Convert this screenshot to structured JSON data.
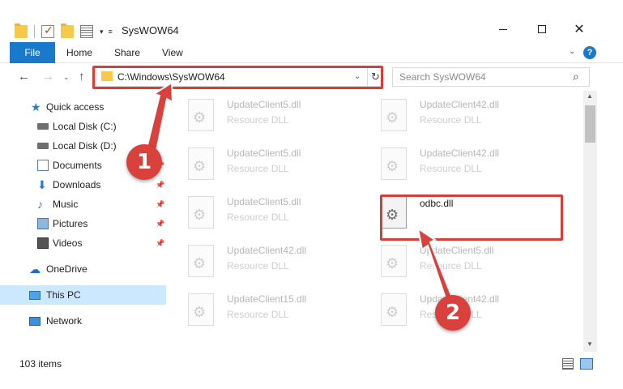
{
  "window": {
    "title": "SysWOW64",
    "minimize_icon": "minimize-icon",
    "maximize_icon": "maximize-icon",
    "close_glyph": "✕"
  },
  "ribbon": {
    "tabs": [
      {
        "label": "File"
      },
      {
        "label": "Home"
      },
      {
        "label": "Share"
      },
      {
        "label": "View"
      }
    ],
    "help_glyph": "?"
  },
  "navigation": {
    "back_glyph": "←",
    "forward_glyph": "→",
    "up_glyph": "↑",
    "address": "C:\\Windows\\SysWOW64",
    "search_placeholder": "Search SysWOW64"
  },
  "sidebar": {
    "items": [
      {
        "label": "Quick access",
        "icon": "star-icon",
        "pinned": false
      },
      {
        "label": "Local Disk (C:)",
        "icon": "disk-icon",
        "pinned": false
      },
      {
        "label": "Local Disk (D:)",
        "icon": "disk-icon",
        "pinned": false
      },
      {
        "label": "Documents",
        "icon": "documents-icon",
        "pinned": true
      },
      {
        "label": "Downloads",
        "icon": "downloads-icon",
        "pinned": true
      },
      {
        "label": "Music",
        "icon": "music-icon",
        "pinned": true
      },
      {
        "label": "Pictures",
        "icon": "pictures-icon",
        "pinned": true
      },
      {
        "label": "Videos",
        "icon": "videos-icon",
        "pinned": true
      },
      {
        "label": "OneDrive",
        "icon": "onedrive-icon",
        "pinned": false
      },
      {
        "label": "This PC",
        "icon": "this-pc-icon",
        "pinned": false,
        "selected": true
      },
      {
        "label": "Network",
        "icon": "network-icon",
        "pinned": false
      }
    ]
  },
  "files": [
    {
      "name": "UpdateClient5.dll",
      "type": "Resource DLL"
    },
    {
      "name": "UpdateClient42.dll",
      "type": "Resource DLL"
    },
    {
      "name": "UpdateClient5.dll",
      "type": "Resource DLL"
    },
    {
      "name": "UpdateClient42.dll",
      "type": "Resource DLL"
    },
    {
      "name": "UpdateClient5.dll",
      "type": "Resource DLL"
    },
    {
      "name": "odbc.dll",
      "type": ""
    },
    {
      "name": "UpdateClient42.dll",
      "type": "Resource DLL"
    },
    {
      "name": "UpdateClient5.dll",
      "type": "Resource DLL"
    },
    {
      "name": "UpdateClient15.dll",
      "type": "Resource DLL"
    },
    {
      "name": "UpdateClient42.dll",
      "type": "Resource DLL"
    }
  ],
  "callouts": [
    "1",
    "2"
  ],
  "status": {
    "item_count": "103 items"
  },
  "colors": {
    "accent": "#1979ca",
    "highlight": "#d43f3a",
    "selection": "#cce8ff"
  }
}
